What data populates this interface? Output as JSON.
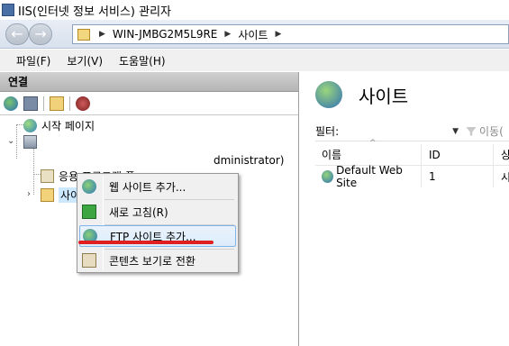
{
  "window": {
    "title": "IIS(인터넷 정보 서비스) 관리자"
  },
  "addressbar": {
    "back_glyph": "←",
    "forward_glyph": "→",
    "breadcrumb": [
      "WIN-JMBG2M5L9RE",
      "사이트"
    ],
    "arrow_glyph": "▶"
  },
  "menu": {
    "items": [
      "파일(F)",
      "보기(V)",
      "도움말(H)"
    ]
  },
  "connections": {
    "header": "연결",
    "toolbar_icons": [
      "globe-icon",
      "save-icon",
      "folder-up-icon",
      "connect-icon"
    ],
    "tree": {
      "start_page": "시작 페이지",
      "server_suffix": "dministrator)",
      "app_pools": "응용 프로그램 풀",
      "sites": "사이트"
    }
  },
  "context_menu": {
    "items": [
      {
        "label": "웹 사이트 추가...",
        "icon": "web-site-icon"
      },
      {
        "label": "새로 고침(R)",
        "icon": "refresh-icon"
      },
      {
        "label": "FTP 사이트 추가...",
        "icon": "ftp-site-icon",
        "highlighted": true
      },
      {
        "label": "콘텐츠 보기로 전환",
        "icon": "content-view-icon"
      }
    ]
  },
  "main": {
    "title": "사이트",
    "filter_label": "필터:",
    "filter_go_label": "이동(",
    "columns": [
      "이름",
      "ID",
      "상"
    ],
    "rows": [
      {
        "name": "Default Web Site",
        "id": "1",
        "state": "시"
      }
    ]
  },
  "colors": {
    "highlight_border": "#7eb4ea",
    "annotation_underline": "#e02020"
  }
}
